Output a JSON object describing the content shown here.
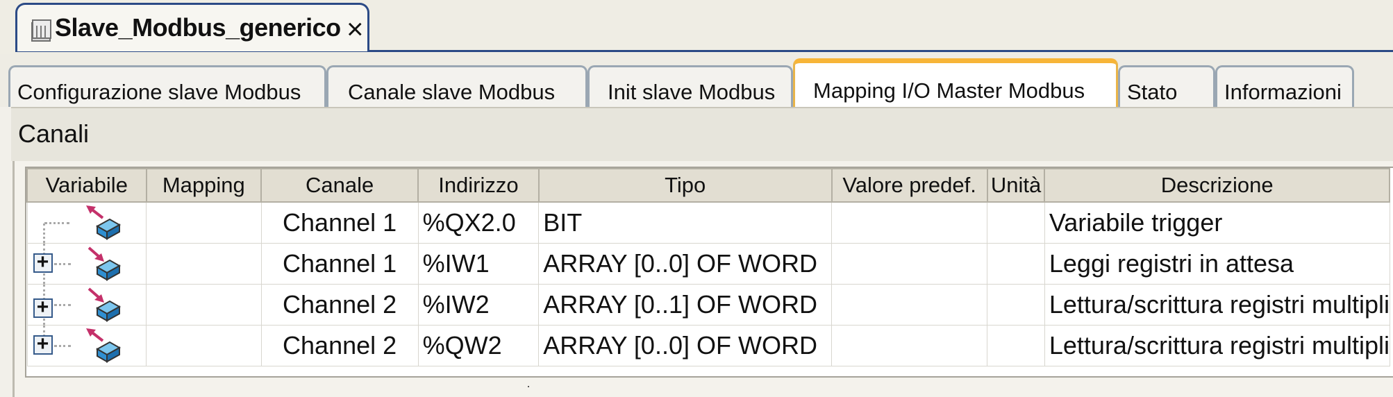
{
  "document_tab": {
    "title": "Slave_Modbus_generico",
    "close_glyph": "×",
    "icon": "device-icon"
  },
  "subtabs": [
    {
      "label": "Configurazione slave Modbus",
      "active": false
    },
    {
      "label": "Canale slave Modbus",
      "active": false
    },
    {
      "label": "Init slave Modbus",
      "active": false
    },
    {
      "label": "Mapping I/O Master Modbus",
      "active": true
    },
    {
      "label": "Stato",
      "active": false
    },
    {
      "label": "Informazioni",
      "active": false
    }
  ],
  "section": {
    "title": "Canali"
  },
  "table": {
    "columns": [
      "Variabile",
      "Mapping",
      "Canale",
      "Indirizzo",
      "Tipo",
      "Valore predef.",
      "Unità",
      "Descrizione"
    ],
    "rows": [
      {
        "variabile": "",
        "mapping": "",
        "canale": "Channel 1",
        "indirizzo": "%QX2.0",
        "tipo": "BIT",
        "valore": "",
        "unita": "",
        "descrizione": "Variabile trigger",
        "expandable": false,
        "direction": "output"
      },
      {
        "variabile": "",
        "mapping": "",
        "canale": "Channel 1",
        "indirizzo": "%IW1",
        "tipo": "ARRAY [0..0] OF WORD",
        "valore": "",
        "unita": "",
        "descrizione": "Leggi registri in attesa",
        "expandable": true,
        "direction": "input"
      },
      {
        "variabile": "",
        "mapping": "",
        "canale": "Channel 2",
        "indirizzo": "%IW2",
        "tipo": "ARRAY [0..1] OF WORD",
        "valore": "",
        "unita": "",
        "descrizione": "Lettura/scrittura registri multipli",
        "expandable": true,
        "direction": "input"
      },
      {
        "variabile": "",
        "mapping": "",
        "canale": "Channel 2",
        "indirizzo": "%QW2",
        "tipo": "ARRAY [0..0] OF WORD",
        "valore": "",
        "unita": "",
        "descrizione": "Lettura/scrittura registri multipli",
        "expandable": true,
        "direction": "output"
      }
    ]
  },
  "colors": {
    "doc_tab_border": "#2b4a86",
    "active_tab_accent": "#f7b538",
    "arrow": "#c4316a",
    "cube_blue": "#3a9fdc"
  }
}
